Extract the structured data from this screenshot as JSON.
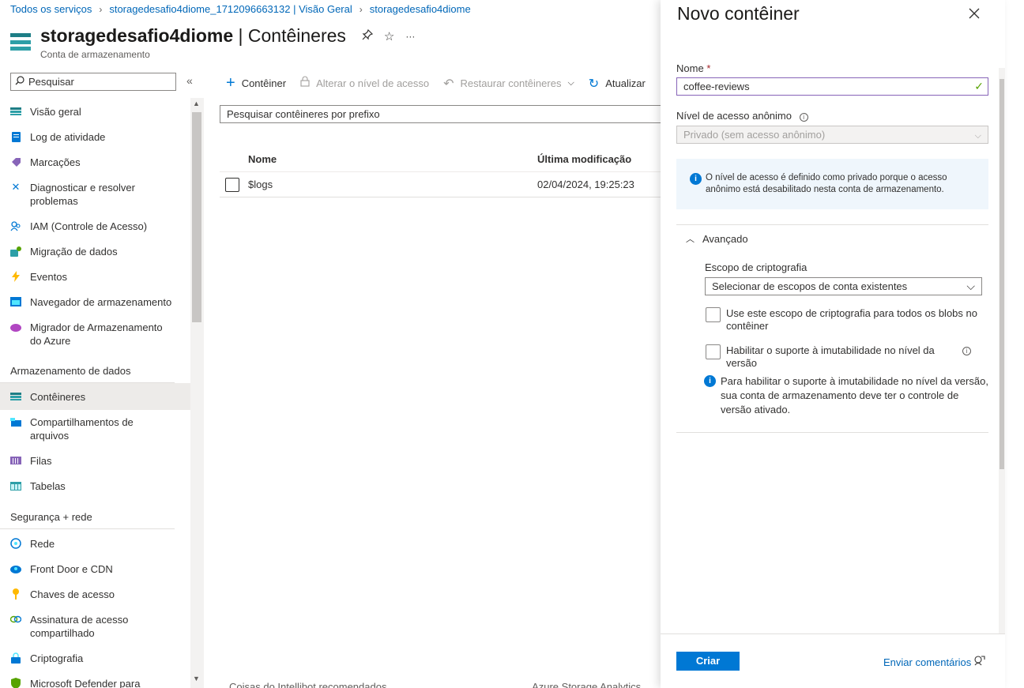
{
  "breadcrumb": {
    "items": [
      "Todos os serviços",
      "storagedesafio4diome_1712096663132 | Visão Geral",
      "storagedesafio4diome"
    ]
  },
  "header": {
    "title_bold": "storagedesafio4diome",
    "title_rest": " | Contêineres",
    "subtitle": "Conta de armazenamento",
    "more": "···"
  },
  "sidebar": {
    "search_placeholder": "Pesquisar",
    "collapse": "«",
    "items": [
      {
        "label": "Visão geral",
        "icon": "storage-icon",
        "color": "#2d9fa7"
      },
      {
        "label": "Log de atividade",
        "icon": "log-icon",
        "color": "#0078d4"
      },
      {
        "label": "Marcações",
        "icon": "tag-icon",
        "color": "#8764b8"
      },
      {
        "label": "Diagnosticar e resolver problemas",
        "icon": "wrench-icon",
        "color": "#0078d4"
      },
      {
        "label": "IAM (Controle de Acesso)",
        "icon": "people-icon",
        "color": "#0078d4"
      },
      {
        "label": "Migração de dados",
        "icon": "migration-icon",
        "color": "#2d9fa7"
      },
      {
        "label": "Eventos",
        "icon": "lightning-icon",
        "color": "#ffb900"
      },
      {
        "label": "Navegador de armazenamento",
        "icon": "browser-icon",
        "color": "#0078d4"
      },
      {
        "label": "Migrador de Armazenamento do Azure",
        "icon": "cloud-icon",
        "color": "#b146c2"
      }
    ],
    "section_data": "Armazenamento de dados",
    "data_items": [
      {
        "label": "Contêineres",
        "icon": "containers-icon",
        "color": "#2d9fa7"
      },
      {
        "label": "Compartilhamentos de arquivos",
        "icon": "file-share-icon",
        "color": "#0078d4"
      },
      {
        "label": "Filas",
        "icon": "queue-icon",
        "color": "#8764b8"
      },
      {
        "label": "Tabelas",
        "icon": "table-icon",
        "color": "#2d9fa7"
      }
    ],
    "section_security": "Segurança + rede",
    "security_items": [
      {
        "label": "Rede",
        "icon": "network-icon",
        "color": "#0078d4"
      },
      {
        "label": "Front Door e CDN",
        "icon": "cloud-cdn-icon",
        "color": "#0078d4"
      },
      {
        "label": "Chaves de acesso",
        "icon": "key-icon",
        "color": "#ffb900"
      },
      {
        "label": "Assinatura de acesso compartilhado",
        "icon": "link-icon",
        "color": "#57a300"
      },
      {
        "label": "Criptografia",
        "icon": "lock-icon",
        "color": "#0078d4"
      },
      {
        "label": "Microsoft Defender para",
        "icon": "shield-icon",
        "color": "#57a300"
      }
    ]
  },
  "toolbar": {
    "add": "Contêiner",
    "change_access": "Alterar o nível de acesso",
    "restore": "Restaurar contêineres",
    "refresh": "Atualizar"
  },
  "prefix_search": {
    "placeholder": "Pesquisar contêineres por prefixo"
  },
  "table": {
    "headers": {
      "name": "Nome",
      "modified": "Última modificação"
    },
    "rows": [
      {
        "name": "$logs",
        "modified": "02/04/2024, 19:25:23"
      }
    ]
  },
  "bottom_peek": {
    "left": "Coisas do Intellibot recomendados",
    "right": "Azure Storage Analytics"
  },
  "panel": {
    "title": "Novo contêiner",
    "name_label": "Nome",
    "required_mark": "*",
    "name_value": "coffee-reviews",
    "access_label": "Nível de acesso anônimo",
    "access_value": "Privado (sem acesso anônimo)",
    "info_text": "O nível de acesso é definido como privado porque o acesso anônimo está desabilitado nesta conta de armazenamento.",
    "advanced_label": "Avançado",
    "encryption_label": "Escopo de criptografia",
    "encryption_value": "Selecionar de escopos de conta existentes",
    "checkbox_scope": "Use este escopo de criptografia para todos os blobs no contêiner",
    "checkbox_immutability": "Habilitar o suporte à imutabilidade no nível da versão",
    "immutability_note": "Para habilitar o suporte à imutabilidade no nível da versão, sua conta de armazenamento deve ter o controle de versão ativado.",
    "create_button": "Criar",
    "feedback_link": "Enviar comentários"
  }
}
